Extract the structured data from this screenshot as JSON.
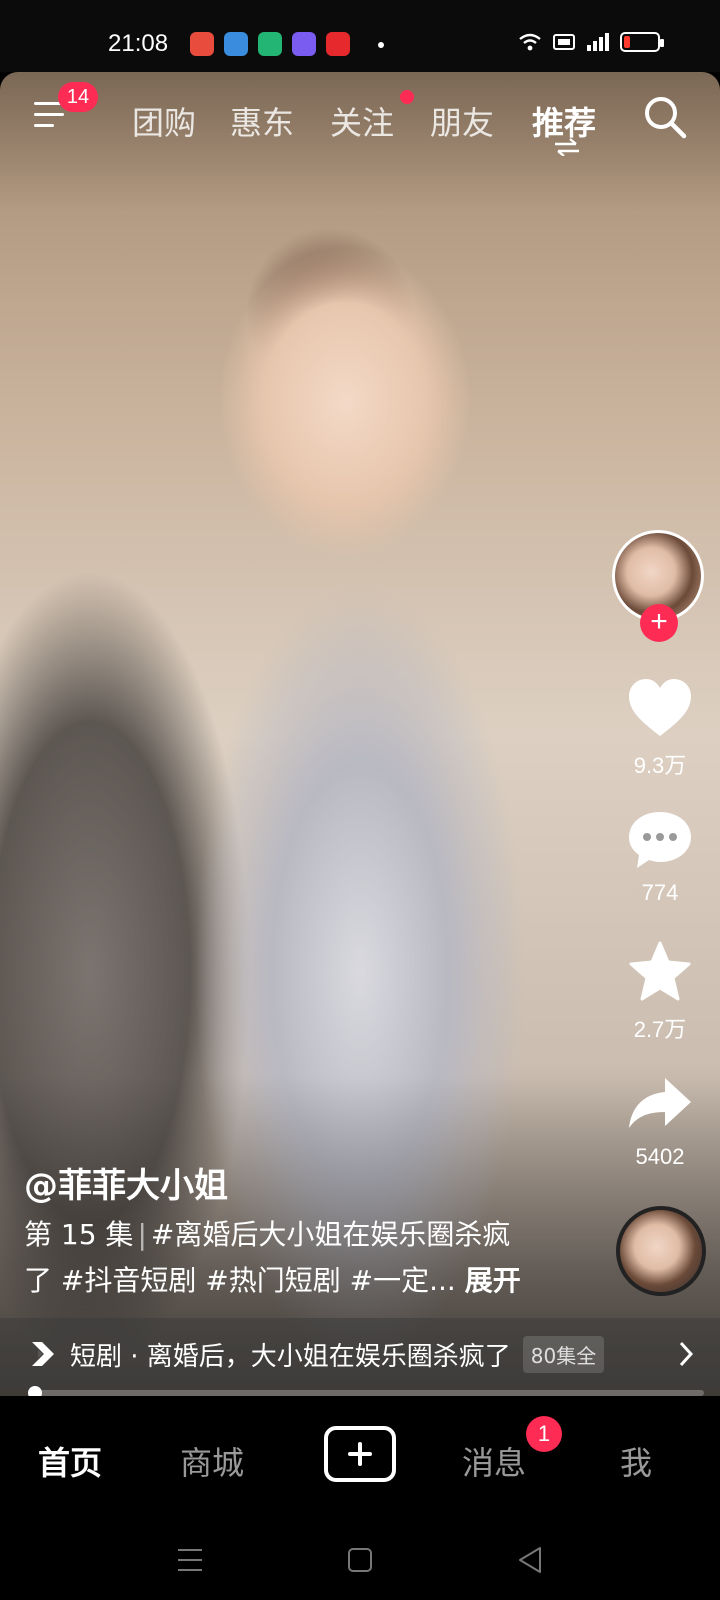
{
  "status_bar": {
    "time": "21:08",
    "app_icons": [
      "music-app-icon",
      "app-icon",
      "battery-app-icon",
      "gallery-app-icon",
      "pinduoduo-app-icon"
    ],
    "app_colors": [
      "#e74c3c",
      "#3a8dde",
      "#22b573",
      "#7a5cf0",
      "#e5292d"
    ]
  },
  "top_nav": {
    "menu_badge": "14",
    "tabs": [
      {
        "label": "团购",
        "active": false
      },
      {
        "label": "惠东",
        "active": false
      },
      {
        "label": "关注",
        "active": false,
        "dot": true
      },
      {
        "label": "朋友",
        "active": false
      },
      {
        "label": "推荐",
        "active": true
      }
    ]
  },
  "rail": {
    "likes": "9.3万",
    "comments": "774",
    "favorites": "2.7万",
    "shares": "5402"
  },
  "caption": {
    "author": "@菲菲大小姐",
    "episode": "第 15 集",
    "separator": "|",
    "line1_rest": "#离婚后大小姐在娱乐圈杀疯",
    "line2": "了 #抖音短剧 #热门短剧 #一定...",
    "expand": "展开"
  },
  "series": {
    "title": "短剧 · 离婚后，大小姐在娱乐圈杀疯了",
    "episodes": "80集全"
  },
  "progress": {
    "value": 0.003
  },
  "tab_bar": {
    "home": "首页",
    "mall": "商城",
    "messages": "消息",
    "messages_badge": "1",
    "me": "我"
  },
  "colors": {
    "accent": "#fe2c55"
  }
}
